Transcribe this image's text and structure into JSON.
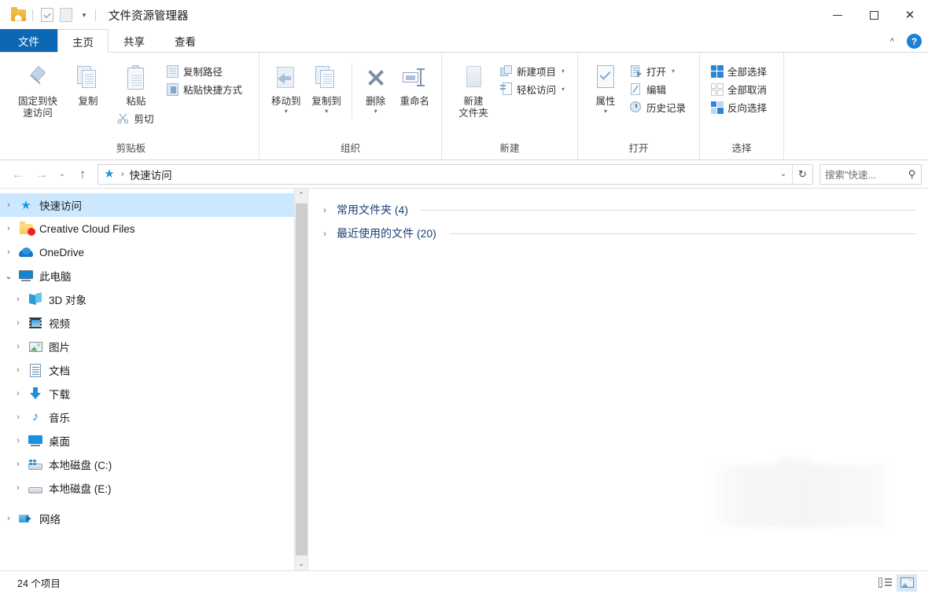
{
  "titlebar": {
    "title": "文件资源管理器",
    "quick_access_icons": [
      "app-folder-icon",
      "properties-icon",
      "new-folder-icon",
      "customize-caret-icon"
    ],
    "minimize_label": "最小化",
    "maximize_label": "最大化",
    "close_label": "关闭"
  },
  "ribbon": {
    "tabs": [
      {
        "label": "文件",
        "state": "file"
      },
      {
        "label": "主页",
        "state": "active"
      },
      {
        "label": "共享",
        "state": "normal"
      },
      {
        "label": "查看",
        "state": "normal"
      }
    ],
    "collapse_label": "^",
    "help_label": "?",
    "groups": [
      {
        "name": "剪贴板",
        "big_buttons": [
          {
            "label_line1": "固定到快",
            "label_line2": "速访问",
            "icon": "pin-icon"
          },
          {
            "label_line1": "复制",
            "label_line2": "",
            "icon": "copy-icon"
          },
          {
            "label_line1": "粘贴",
            "label_line2": "",
            "icon": "paste-icon"
          }
        ],
        "small_buttons": [
          {
            "label": "复制路径",
            "icon": "copy-path-icon"
          },
          {
            "label": "粘贴快捷方式",
            "icon": "paste-shortcut-icon"
          }
        ],
        "inline_button": {
          "label": "剪切",
          "icon": "scissors-icon"
        }
      },
      {
        "name": "组织",
        "big_buttons": [
          {
            "label_line1": "移动到",
            "label_line2": "",
            "icon": "move-to-icon",
            "caret": true
          },
          {
            "label_line1": "复制到",
            "label_line2": "",
            "icon": "copy-to-icon",
            "caret": true
          },
          {
            "label_line1": "删除",
            "label_line2": "",
            "icon": "delete-icon",
            "caret": true
          },
          {
            "label_line1": "重命名",
            "label_line2": "",
            "icon": "rename-icon"
          }
        ]
      },
      {
        "name": "新建",
        "big_buttons": [
          {
            "label_line1": "新建",
            "label_line2": "文件夹",
            "icon": "new-folder-icon"
          }
        ],
        "small_buttons": [
          {
            "label": "新建项目",
            "icon": "new-item-icon",
            "caret": true
          },
          {
            "label": "轻松访问",
            "icon": "easy-access-icon",
            "caret": true
          }
        ]
      },
      {
        "name": "打开",
        "big_buttons": [
          {
            "label_line1": "属性",
            "label_line2": "",
            "icon": "properties-icon",
            "caret": true
          }
        ],
        "small_buttons": [
          {
            "label": "打开",
            "icon": "open-icon",
            "caret": true
          },
          {
            "label": "编辑",
            "icon": "edit-icon"
          },
          {
            "label": "历史记录",
            "icon": "history-icon"
          }
        ]
      },
      {
        "name": "选择",
        "small_buttons": [
          {
            "label": "全部选择",
            "icon": "select-all-icon"
          },
          {
            "label": "全部取消",
            "icon": "select-none-icon"
          },
          {
            "label": "反向选择",
            "icon": "invert-selection-icon"
          }
        ]
      }
    ]
  },
  "addressbar": {
    "back_label": "←",
    "forward_label": "→",
    "recent_label": "⌄",
    "up_label": "↑",
    "breadcrumb_icon": "quick-access-star-icon",
    "breadcrumb": "快速访问",
    "path_caret": "⌄",
    "refresh_label": "↻",
    "search_placeholder": "搜索\"快速...",
    "search_value": "",
    "search_icon": "search-icon"
  },
  "navpane": {
    "items": [
      {
        "label": "快速访问",
        "icon": "star-icon",
        "chevron": "collapsed",
        "level": 0,
        "selected": true
      },
      {
        "label": "Creative Cloud Files",
        "icon": "creative-cloud-icon",
        "chevron": "collapsed",
        "level": 0,
        "selected": false
      },
      {
        "label": "OneDrive",
        "icon": "onedrive-cloud-icon",
        "chevron": "collapsed",
        "level": 0,
        "selected": false
      },
      {
        "label": "此电脑",
        "icon": "this-pc-icon",
        "chevron": "expanded",
        "level": 0,
        "selected": false
      },
      {
        "label": "3D 对象",
        "icon": "3d-objects-icon",
        "chevron": "collapsed",
        "level": 1,
        "selected": false
      },
      {
        "label": "视频",
        "icon": "videos-icon",
        "chevron": "collapsed",
        "level": 1,
        "selected": false
      },
      {
        "label": "图片",
        "icon": "pictures-icon",
        "chevron": "collapsed",
        "level": 1,
        "selected": false
      },
      {
        "label": "文档",
        "icon": "documents-icon",
        "chevron": "collapsed",
        "level": 1,
        "selected": false
      },
      {
        "label": "下载",
        "icon": "downloads-icon",
        "chevron": "collapsed",
        "level": 1,
        "selected": false
      },
      {
        "label": "音乐",
        "icon": "music-icon",
        "chevron": "collapsed",
        "level": 1,
        "selected": false
      },
      {
        "label": "桌面",
        "icon": "desktop-icon",
        "chevron": "collapsed",
        "level": 1,
        "selected": false
      },
      {
        "label": "本地磁盘 (C:)",
        "icon": "system-drive-icon",
        "chevron": "collapsed",
        "level": 1,
        "selected": false
      },
      {
        "label": "本地磁盘 (E:)",
        "icon": "drive-icon",
        "chevron": "collapsed",
        "level": 1,
        "selected": false
      },
      {
        "label": "网络",
        "icon": "network-icon",
        "chevron": "collapsed",
        "level": 0,
        "selected": false
      }
    ],
    "scrollbar": {
      "up": "⌃",
      "down": "⌄"
    }
  },
  "content": {
    "groups": [
      {
        "title": "常用文件夹 (4)",
        "chevron": "›"
      },
      {
        "title": "最近使用的文件 (20)",
        "chevron": "›"
      }
    ]
  },
  "statusbar": {
    "item_count": "24 个项目",
    "view_details_label": "详细信息",
    "view_tiles_label": "大图标"
  },
  "colors": {
    "accent_blue": "#0c67b5",
    "selection_blue": "#cce8ff",
    "group_title_blue": "#1c3f77",
    "star_blue": "#2196e8"
  }
}
